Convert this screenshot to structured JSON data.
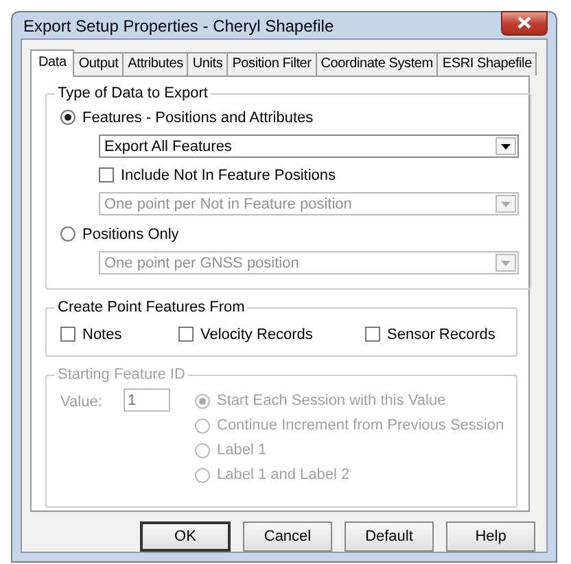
{
  "window": {
    "title": "Export Setup Properties - Cheryl Shapefile"
  },
  "tabs": [
    {
      "label": "Data",
      "selected": true
    },
    {
      "label": "Output",
      "selected": false
    },
    {
      "label": "Attributes",
      "selected": false
    },
    {
      "label": "Units",
      "selected": false
    },
    {
      "label": "Position Filter",
      "selected": false
    },
    {
      "label": "Coordinate System",
      "selected": false
    },
    {
      "label": "ESRI Shapefile",
      "selected": false
    }
  ],
  "type_of_data": {
    "title": "Type of Data to Export",
    "options": [
      {
        "label": "Features - Positions and Attributes",
        "selected": true,
        "controls": [
          {
            "kind": "dropdown",
            "value": "Export All Features",
            "disabled": false
          },
          {
            "kind": "checkbox",
            "label": "Include Not In Feature Positions",
            "checked": false
          },
          {
            "kind": "dropdown",
            "value": "One point per Not in Feature position",
            "disabled": true
          }
        ]
      },
      {
        "label": "Positions Only",
        "selected": false,
        "controls": [
          {
            "kind": "dropdown",
            "value": "One point per GNSS position",
            "disabled": true
          }
        ]
      }
    ]
  },
  "create_point_features": {
    "title": "Create Point Features From",
    "checkboxes": [
      {
        "label": "Notes",
        "checked": false
      },
      {
        "label": "Velocity Records",
        "checked": false
      },
      {
        "label": "Sensor Records",
        "checked": false
      }
    ]
  },
  "starting_feature_id": {
    "title": "Starting Feature ID",
    "disabled": true,
    "value_label": "Value:",
    "value": "1",
    "options": [
      {
        "label": "Start Each Session with this Value",
        "selected": true
      },
      {
        "label": "Continue Increment from Previous Session",
        "selected": false
      },
      {
        "label": "Label 1",
        "selected": false
      },
      {
        "label": "Label 1 and Label 2",
        "selected": false
      }
    ]
  },
  "buttons": [
    {
      "label": "OK",
      "default": true
    },
    {
      "label": "Cancel",
      "default": false
    },
    {
      "label": "Default",
      "default": false
    },
    {
      "label": "Help",
      "default": false
    }
  ]
}
